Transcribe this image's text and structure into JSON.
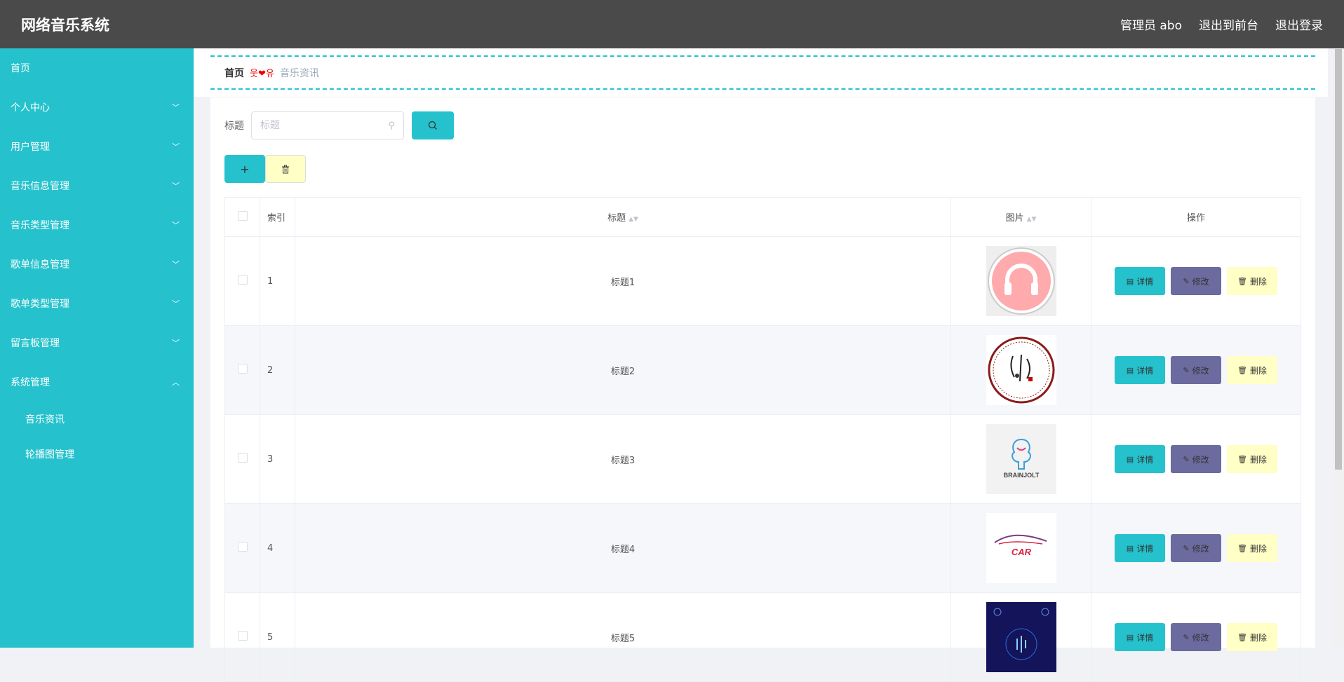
{
  "app": {
    "title": "网络音乐系统"
  },
  "header": {
    "user": "管理员 abo",
    "to_front": "退出到前台",
    "logout": "退出登录"
  },
  "sidebar": {
    "items": [
      {
        "label": "首页",
        "has_children": false
      },
      {
        "label": "个人中心",
        "has_children": true
      },
      {
        "label": "用户管理",
        "has_children": true
      },
      {
        "label": "音乐信息管理",
        "has_children": true
      },
      {
        "label": "音乐类型管理",
        "has_children": true
      },
      {
        "label": "歌单信息管理",
        "has_children": true
      },
      {
        "label": "歌单类型管理",
        "has_children": true
      },
      {
        "label": "留言板管理",
        "has_children": true
      },
      {
        "label": "系统管理",
        "has_children": true,
        "expanded": true
      }
    ],
    "subitems": [
      {
        "label": "音乐资讯"
      },
      {
        "label": "轮播图管理"
      }
    ]
  },
  "breadcrumb": {
    "home": "首页",
    "separator": "웃❤유",
    "current": "音乐资讯"
  },
  "search": {
    "label": "标题",
    "placeholder": "标题"
  },
  "table": {
    "headers": {
      "index": "索引",
      "title": "标题",
      "image": "图片",
      "actions": "操作"
    },
    "rows": [
      {
        "index": "1",
        "title": "标题1"
      },
      {
        "index": "2",
        "title": "标题2"
      },
      {
        "index": "3",
        "title": "标题3"
      },
      {
        "index": "4",
        "title": "标题4"
      },
      {
        "index": "5",
        "title": "标题5"
      }
    ],
    "actions": {
      "detail": "详情",
      "edit": "修改",
      "delete": "删除"
    }
  },
  "images": {
    "brand_text": "BRAINJOLT",
    "car_text": "CAR"
  },
  "colors": {
    "accent": "#25c2cd",
    "header": "#4a4a4a",
    "edit": "#6b6b9f",
    "delete": "#ffffc6",
    "separator": "#e00000"
  }
}
